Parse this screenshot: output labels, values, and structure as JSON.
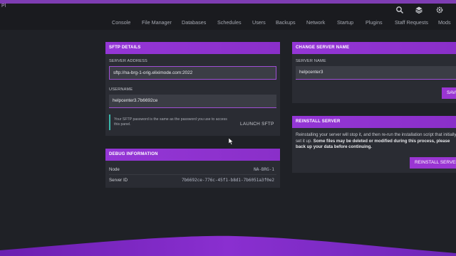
{
  "topbar": {
    "logo": "Pl",
    "icons": [
      "search-icon",
      "layers-icon",
      "gear-icon"
    ]
  },
  "nav": {
    "items": [
      "Console",
      "File Manager",
      "Databases",
      "Schedules",
      "Users",
      "Backups",
      "Network",
      "Startup",
      "Plugins",
      "Staff Requests",
      "Mods"
    ]
  },
  "sftp": {
    "title": "SFTP DETAILS",
    "address_label": "SERVER ADDRESS",
    "address_value": "sftp://na-brg-1-orig.eliximode.com:2022",
    "username_label": "USERNAME",
    "username_value": "helpcenter3.7b6692ce",
    "note": "Your SFTP password is the same as the password you use to access this panel.",
    "launch_label": "LAUNCH SFTP"
  },
  "debug": {
    "title": "DEBUG INFORMATION",
    "node_label": "Node",
    "node_value": "NA-BRG-1",
    "server_id_label": "Server ID",
    "server_id_value": "7b6692ce-776c-45f1-b8d1-7b6051a3f0e2"
  },
  "change_name": {
    "title": "CHANGE SERVER NAME",
    "name_label": "SERVER NAME",
    "name_value": "helpcenter3",
    "save_label": "SAVE"
  },
  "reinstall": {
    "title": "REINSTALL SERVER",
    "text_plain": "Reinstalling your server will stop it, and then re-run the installation script that initially set it up.",
    "text_bold": "Some files may be deleted or modified during this process, please back up your data before continuing.",
    "button_label": "REINSTALL SERVER"
  },
  "colors": {
    "accent": "#9436d6",
    "background": "#1f2126",
    "panel": "#2a2c33",
    "note_border": "#3ab6a9"
  }
}
